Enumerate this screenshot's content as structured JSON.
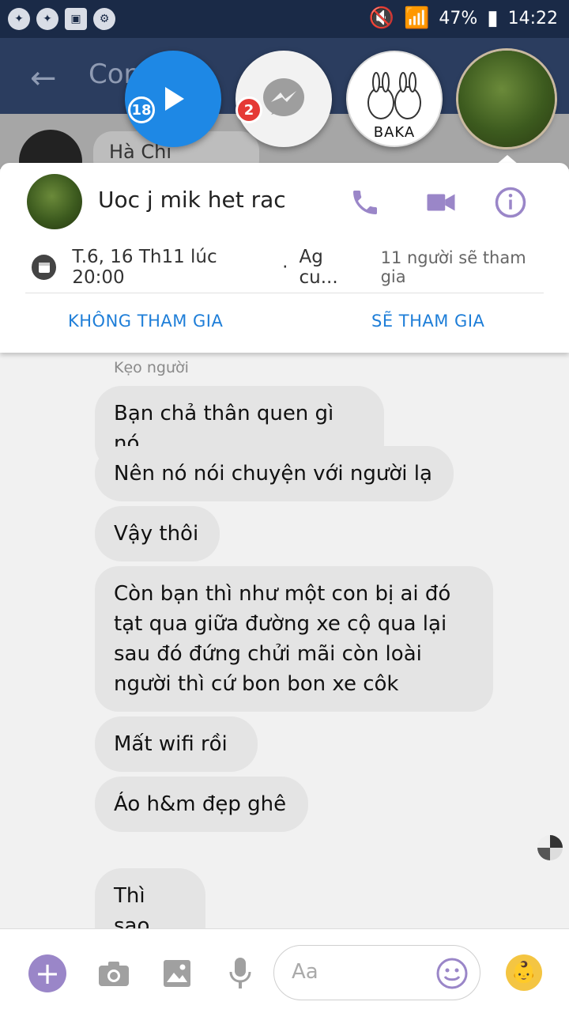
{
  "status_bar": {
    "battery_percent": "47%",
    "time": "14:22"
  },
  "app_bar": {
    "title_partial": "Con"
  },
  "behind_conversation": {
    "name_partial": "Hà Chi"
  },
  "chat_heads": {
    "play_badge": "18",
    "messenger_badge": "2",
    "baka_label": "BAKA"
  },
  "conversation": {
    "title": "Uoc j mik het rac",
    "event_time": "T.6, 16 Th11 lúc 20:00",
    "event_separator": "·",
    "event_location": "Ag cu...",
    "event_going": "11 người sẽ tham gia",
    "decline_label": "KHÔNG THAM GIA",
    "accept_label": "SẼ THAM GIA"
  },
  "messages": {
    "sender": "Kẹo người",
    "items": [
      "Bạn chả thân quen gì nó",
      "Nên nó nói chuyện với người lạ",
      "Vậy thôi",
      "Còn bạn thì như một con bị ai đó tạt qua giữa đường xe cộ qua lại sau đó đứng chửi mãi còn loài người thì cứ bon bon xe côk",
      "Mất wifi rồi",
      "Áo h&m đẹp ghê",
      "Thì sao"
    ]
  },
  "composer": {
    "placeholder": "Aa"
  },
  "colors": {
    "accent": "#9a86c8",
    "link_blue": "#1e7ed8",
    "status_bar": "#1a2a47",
    "app_bar": "#2b3d5f",
    "bubble": "#e4e4e4"
  }
}
